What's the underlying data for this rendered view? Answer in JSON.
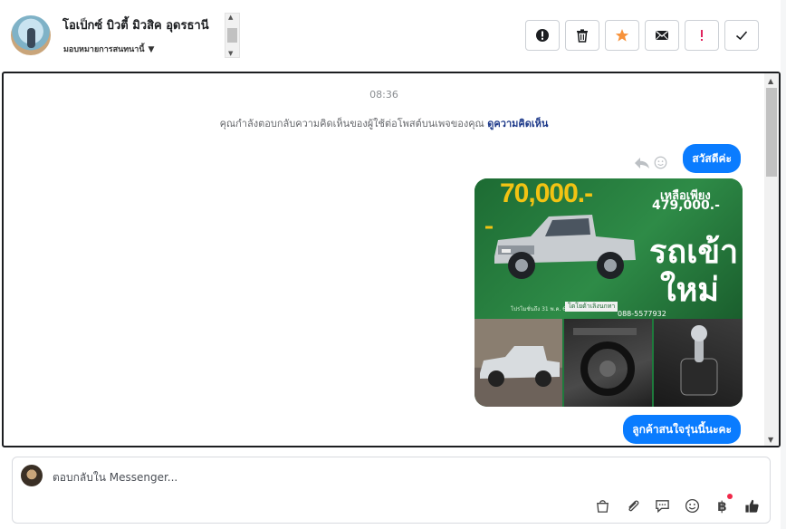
{
  "header": {
    "title": "โอเป็กซ์ บิวตี้ มิวสิค อุดรธานี",
    "subtitle": "มอบหมายการสนทนานี้",
    "actions": [
      {
        "name": "spam-button",
        "icon": "alert-circle-icon"
      },
      {
        "name": "delete-button",
        "icon": "trash-icon"
      },
      {
        "name": "star-button",
        "icon": "star-icon"
      },
      {
        "name": "mark-unread-button",
        "icon": "envelope-icon"
      },
      {
        "name": "important-button",
        "icon": "exclamation-icon"
      },
      {
        "name": "mark-done-button",
        "icon": "check-icon"
      }
    ]
  },
  "conversation": {
    "timestamp": "08:36",
    "notice_text": "คุณกำลังตอบกลับความคิดเห็นของผู้ใช้ต่อโพสต์บนเพจของคุณ ",
    "notice_link": "ดูความคิดเห็น",
    "messages": [
      {
        "text": "สวัสดีค่ะ"
      },
      {
        "text": "ลูกค้าสนใจรุ่นนี้นะคะ"
      }
    ],
    "image": {
      "price_headline": "70,000.-",
      "remaining_label": "เหลือเพียง",
      "remaining_price": "479,000.-",
      "tag_line1": "รถเข้า",
      "tag_line2": "ใหม่",
      "phone": "088-5577932",
      "dealer": "โตโยต้าเลิงนกทา",
      "fine_print": "โปรโมชั่นถึง 31 พ.ค. 67"
    }
  },
  "composer": {
    "placeholder": "ตอบกลับใน Messenger...",
    "tools": [
      "shopping-bag-icon",
      "paperclip-icon",
      "chat-template-icon",
      "emoji-icon",
      "baht-payment-icon",
      "like-icon"
    ],
    "baht_symbol": "฿"
  },
  "colors": {
    "accent": "#0a7cff",
    "star": "#f7923a",
    "important": "#e0245e"
  }
}
